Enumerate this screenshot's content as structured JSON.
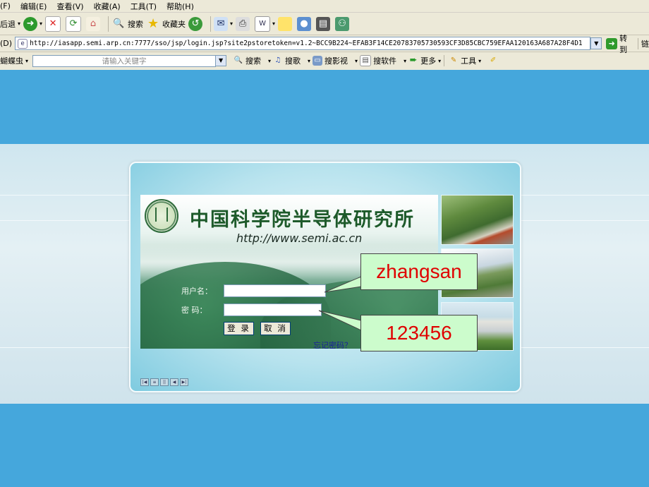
{
  "menubar": {
    "items": [
      "(F)",
      "编辑(E)",
      "查看(V)",
      "收藏(A)",
      "工具(T)",
      "帮助(H)"
    ]
  },
  "toolbar": {
    "back_label": "后退",
    "search_label": "搜索",
    "favorites_label": "收藏夹"
  },
  "addressbar": {
    "label": "(D)",
    "url": "http://iasapp.semi.arp.cn:7777/sso/jsp/login.jsp?site2pstoretoken=v1.2~BCC9B224~EFAB3F14CE20783705730593CF3D85CBC759EFAA120163A687A28F4D1",
    "go_label": "转到",
    "links_label": "链"
  },
  "searchbar": {
    "brand": "蝴蝶虫",
    "placeholder": "请输入关键字",
    "items": [
      "搜索",
      "搜歌",
      "搜影视",
      "搜软件",
      "更多",
      "工具"
    ]
  },
  "login": {
    "institute_name": "中国科学院半导体研究所",
    "institute_url": "http://www.semi.ac.cn",
    "username_label": "用户名：",
    "password_label": "密  码：",
    "login_button": "登 录",
    "cancel_button": "取 消",
    "forgot_link": "忘记密码？"
  },
  "annotations": {
    "username_callout": "zhangsan",
    "password_callout": "123456"
  },
  "colors": {
    "page_bg": "#45a7dc",
    "callout_bg": "#ccfccc",
    "callout_text": "#e00000"
  }
}
